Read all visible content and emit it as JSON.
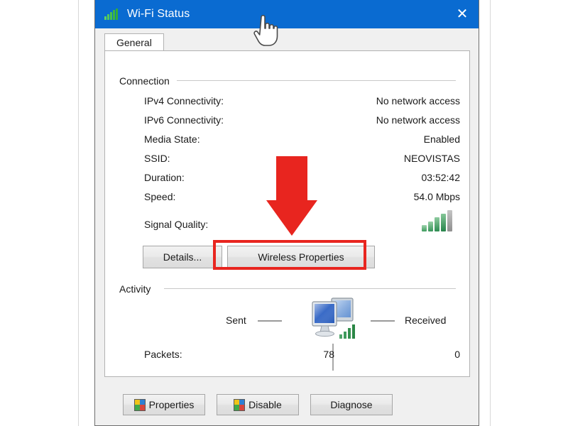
{
  "window": {
    "title": "Wi-Fi Status",
    "title_icon": "wifi-signal-icon",
    "close_label": "✕"
  },
  "tabs": [
    {
      "label": "General",
      "selected": true
    }
  ],
  "connection": {
    "group_label": "Connection",
    "rows": [
      {
        "label": "IPv4 Connectivity:",
        "value": "No network access"
      },
      {
        "label": "IPv6 Connectivity:",
        "value": "No network access"
      },
      {
        "label": "Media State:",
        "value": "Enabled"
      },
      {
        "label": "SSID:",
        "value": "NEOVISTAS"
      },
      {
        "label": "Duration:",
        "value": "03:52:42"
      },
      {
        "label": "Speed:",
        "value": "54.0 Mbps"
      },
      {
        "label": "Signal Quality:",
        "value": ""
      }
    ],
    "signal_quality_bars": 4,
    "signal_quality_total_bars": 5,
    "buttons": {
      "details": "Details...",
      "wireless_properties": "Wireless Properties"
    }
  },
  "activity": {
    "group_label": "Activity",
    "sent_label": "Sent",
    "received_label": "Received",
    "packets_label": "Packets:",
    "packets_sent": "78",
    "packets_received": "0",
    "center_icon": "network-computers-icon"
  },
  "footer": {
    "buttons": [
      {
        "label": "Properties",
        "icon": "uac-shield-icon",
        "has_shield": true
      },
      {
        "label": "Disable",
        "icon": "uac-shield-icon",
        "has_shield": true
      },
      {
        "label": "Diagnose",
        "icon": "",
        "has_shield": false
      }
    ]
  },
  "annotations": {
    "arrow_color": "#e8251f",
    "highlight_color": "#e8251f",
    "arrow_points_to": "Wireless Properties",
    "cursor": "pointing-hand-cursor"
  },
  "colors": {
    "titlebar": "#0a6bd1",
    "window_face": "#f0f0f0",
    "page_face": "#ffffff",
    "accent_red": "#e8251f",
    "signal_green": "#2f8c52"
  }
}
